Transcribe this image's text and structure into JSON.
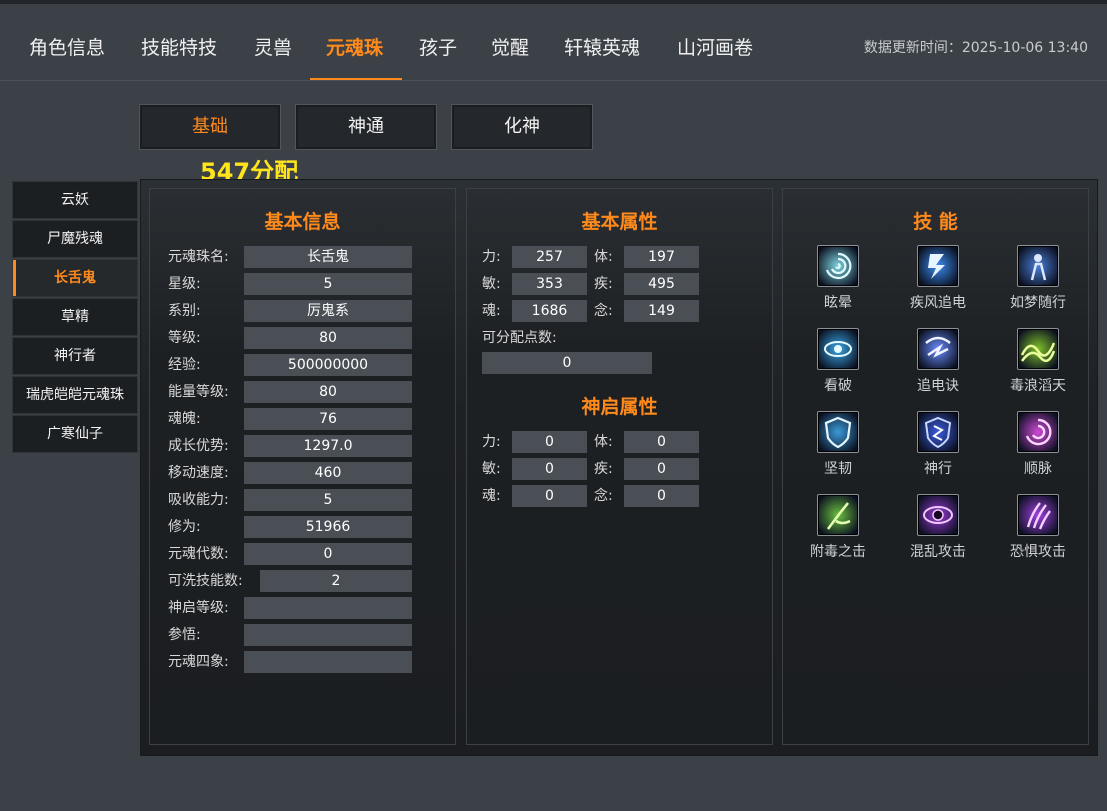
{
  "nav": {
    "tabs": [
      "角色信息",
      "技能特技",
      "灵兽",
      "元魂珠",
      "孩子",
      "觉醒",
      "轩辕英魂",
      "山河画卷"
    ],
    "active_tab": "元魂珠",
    "update_label": "数据更新时间：",
    "update_time": "2025-10-06 13:40"
  },
  "subtabs": [
    "基础",
    "神通",
    "化神"
  ],
  "active_subtab": "基础",
  "allocation_label": "547分配",
  "soul_list": {
    "items": [
      "云妖",
      "尸魔残魂",
      "长舌鬼",
      "草精",
      "神行者",
      "瑞虎皑皑元魂珠",
      "广寒仙子"
    ],
    "active": "长舌鬼"
  },
  "basic_info": {
    "title": "基本信息",
    "rows": [
      {
        "label": "元魂珠名:",
        "value": "长舌鬼"
      },
      {
        "label": "星级:",
        "value": "5"
      },
      {
        "label": "系别:",
        "value": "厉鬼系"
      },
      {
        "label": "等级:",
        "value": "80"
      },
      {
        "label": "经验:",
        "value": "500000000"
      },
      {
        "label": "能量等级:",
        "value": "80"
      },
      {
        "label": "魂魄:",
        "value": "76"
      },
      {
        "label": "成长优势:",
        "value": "1297.0"
      },
      {
        "label": "移动速度:",
        "value": "460"
      },
      {
        "label": "吸收能力:",
        "value": "5"
      },
      {
        "label": "修为:",
        "value": "51966"
      },
      {
        "label": "元魂代数:",
        "value": "0"
      },
      {
        "label": "可洗技能数:",
        "value": "2"
      },
      {
        "label": "神启等级:",
        "value": ""
      },
      {
        "label": "参悟:",
        "value": ""
      },
      {
        "label": "元魂四象:",
        "value": ""
      }
    ]
  },
  "basic_attrs": {
    "title": "基本属性",
    "items": [
      {
        "label": "力:",
        "value": "257"
      },
      {
        "label": "体:",
        "value": "197"
      },
      {
        "label": "敏:",
        "value": "353"
      },
      {
        "label": "疾:",
        "value": "495"
      },
      {
        "label": "魂:",
        "value": "1686"
      },
      {
        "label": "念:",
        "value": "149"
      }
    ],
    "points_label": "可分配点数:",
    "points_value": "0"
  },
  "divine_attrs": {
    "title": "神启属性",
    "items": [
      {
        "label": "力:",
        "value": "0"
      },
      {
        "label": "体:",
        "value": "0"
      },
      {
        "label": "敏:",
        "value": "0"
      },
      {
        "label": "疾:",
        "value": "0"
      },
      {
        "label": "魂:",
        "value": "0"
      },
      {
        "label": "念:",
        "value": "0"
      }
    ]
  },
  "skills": {
    "title": "技 能",
    "items": [
      {
        "name": "眩晕",
        "icon": "swirl-icon",
        "color": "#7fd4e0"
      },
      {
        "name": "疾风追电",
        "icon": "lightning-blue-icon",
        "color": "#3a8cf0"
      },
      {
        "name": "如梦随行",
        "icon": "dream-figure-icon",
        "color": "#4a7ed8"
      },
      {
        "name": "看破",
        "icon": "eye-burst-icon",
        "color": "#38a8e8"
      },
      {
        "name": "追电诀",
        "icon": "lightning-storm-icon",
        "color": "#6a8cff"
      },
      {
        "name": "毒浪滔天",
        "icon": "poison-wave-icon",
        "color": "#7fc02a"
      },
      {
        "name": "坚韧",
        "icon": "shield-icon",
        "color": "#3a9ad8"
      },
      {
        "name": "神行",
        "icon": "rune-shield-icon",
        "color": "#3b5ce0"
      },
      {
        "name": "顺脉",
        "icon": "pink-swirl-icon",
        "color": "#d04ad8"
      },
      {
        "name": "附毒之击",
        "icon": "poison-strike-icon",
        "color": "#6ac040"
      },
      {
        "name": "混乱攻击",
        "icon": "chaos-eye-icon",
        "color": "#9a3ad8"
      },
      {
        "name": "恐惧攻击",
        "icon": "fear-claw-icon",
        "color": "#a040e0"
      }
    ]
  }
}
